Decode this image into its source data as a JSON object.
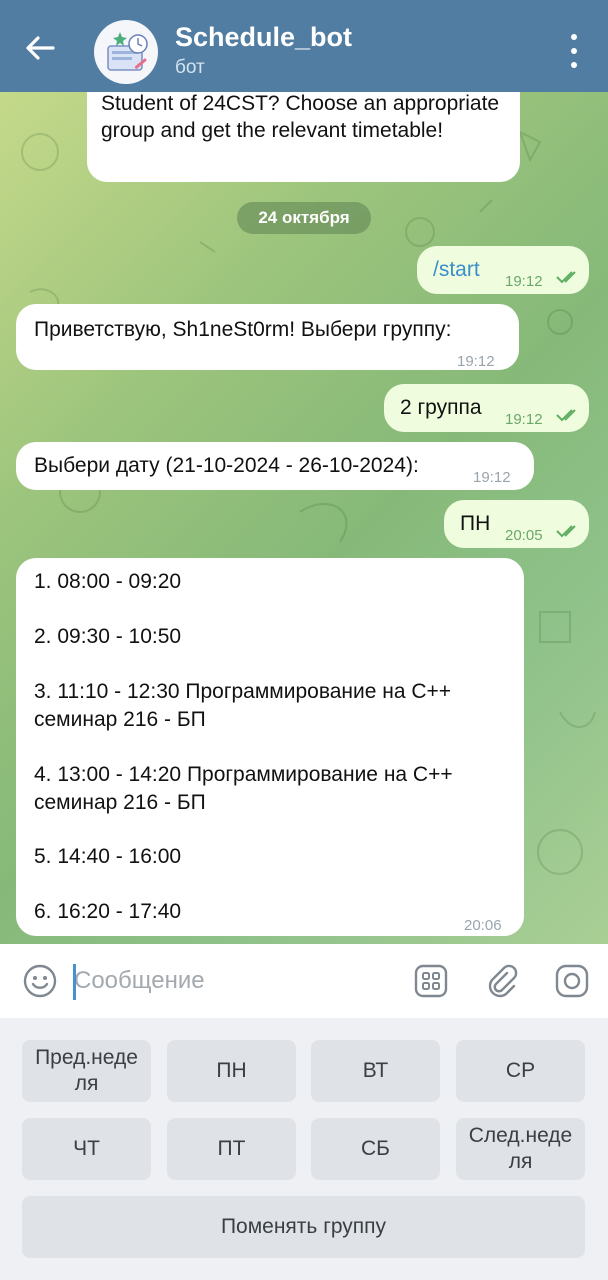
{
  "header": {
    "title": "Schedule_bot",
    "subtitle": "бот"
  },
  "messages": {
    "intro": {
      "text": "Student of 24CST? Choose an appropriate group and get the relevant timetable!"
    },
    "date_chip": "24 октября",
    "start": {
      "text": "/start",
      "time": "19:12"
    },
    "greet": {
      "text": "Приветствую, Sh1neSt0rm! Выбери группу:",
      "time": "19:12"
    },
    "group": {
      "text": "2 группа",
      "time": "19:12"
    },
    "pick_date": {
      "text": "Выбери дату (21-10-2024 - 26-10-2024):",
      "time": "19:12"
    },
    "day": {
      "text": "ПН",
      "time": "20:05"
    },
    "schedule": {
      "lines": [
        "1. 08:00 - 09:20",
        "2. 09:30 - 10:50",
        "3. 11:10 - 12:30 Программирование на C++",
        "семинар 216 - БП",
        "4. 13:00 - 14:20 Программирование на C++",
        "семинар 216 - БП",
        "5. 14:40 - 16:00",
        "6. 16:20 - 17:40"
      ],
      "time": "20:06"
    }
  },
  "composer": {
    "placeholder": "Сообщение"
  },
  "keyboard": {
    "prev_week": "Пред.неделя",
    "mon": "ПН",
    "tue": "ВТ",
    "wed": "СР",
    "thu": "ЧТ",
    "fri": "ПТ",
    "sat": "СБ",
    "next_week": "След.неделя",
    "change_group": "Поменять группу"
  },
  "colors": {
    "header": "#517da2",
    "incoming": "#ffffff",
    "outgoing": "#effdde",
    "accent": "#4a8fd0"
  },
  "icons": [
    "back-arrow-icon",
    "more-vert-icon",
    "emoji-icon",
    "bot-keyboard-icon",
    "attach-icon",
    "camera-icon",
    "double-check-icon"
  ]
}
